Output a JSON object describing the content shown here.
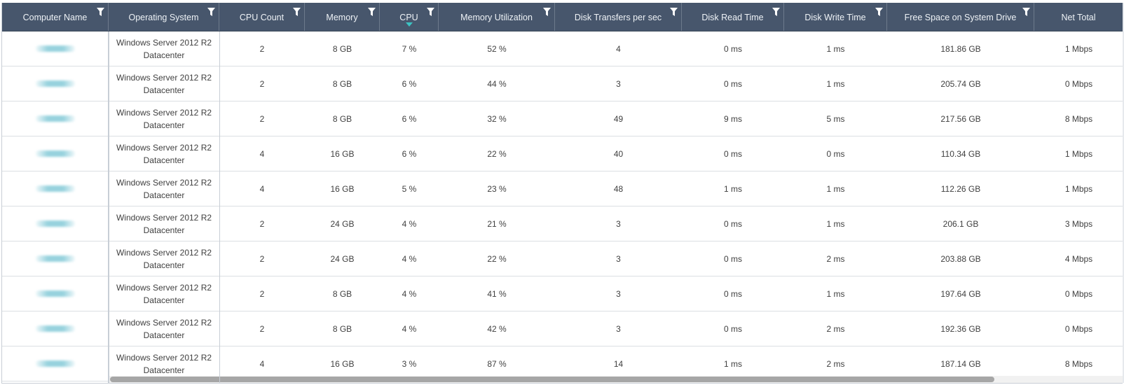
{
  "columns": [
    {
      "key": "computer",
      "label": "Computer Name"
    },
    {
      "key": "os",
      "label": "Operating System"
    },
    {
      "key": "cpu_count",
      "label": "CPU Count"
    },
    {
      "key": "memory",
      "label": "Memory"
    },
    {
      "key": "cpu",
      "label": "CPU"
    },
    {
      "key": "mem_util",
      "label": "Memory Utilization"
    },
    {
      "key": "disk_transfers",
      "label": "Disk Transfers per sec"
    },
    {
      "key": "disk_read",
      "label": "Disk Read Time"
    },
    {
      "key": "disk_write",
      "label": "Disk Write Time"
    },
    {
      "key": "free_space",
      "label": "Free Space on System Drive"
    },
    {
      "key": "net_total",
      "label": "Net Total"
    }
  ],
  "sorted_column": "cpu",
  "sort_direction": "descending",
  "icons": {
    "filter": "filter-icon",
    "sort": "sort-descending-icon"
  },
  "colors": {
    "header_bg": "#47566c",
    "sort_accent": "#3cc3c3"
  },
  "rows": [
    {
      "os": "Windows Server 2012 R2 Datacenter",
      "cpu_count": "2",
      "memory": "8 GB",
      "cpu": "7 %",
      "mem_util": "52 %",
      "disk_transfers": "4",
      "disk_read": "0 ms",
      "disk_write": "1 ms",
      "free_space": "181.86 GB",
      "net_total": "1 Mbps"
    },
    {
      "os": "Windows Server 2012 R2 Datacenter",
      "cpu_count": "2",
      "memory": "8 GB",
      "cpu": "6 %",
      "mem_util": "44 %",
      "disk_transfers": "3",
      "disk_read": "0 ms",
      "disk_write": "1 ms",
      "free_space": "205.74 GB",
      "net_total": "0 Mbps"
    },
    {
      "os": "Windows Server 2012 R2 Datacenter",
      "cpu_count": "2",
      "memory": "8 GB",
      "cpu": "6 %",
      "mem_util": "32 %",
      "disk_transfers": "49",
      "disk_read": "9 ms",
      "disk_write": "5 ms",
      "free_space": "217.56 GB",
      "net_total": "8 Mbps"
    },
    {
      "os": "Windows Server 2012 R2 Datacenter",
      "cpu_count": "4",
      "memory": "16 GB",
      "cpu": "6 %",
      "mem_util": "22 %",
      "disk_transfers": "40",
      "disk_read": "0 ms",
      "disk_write": "0 ms",
      "free_space": "110.34 GB",
      "net_total": "1 Mbps"
    },
    {
      "os": "Windows Server 2012 R2 Datacenter",
      "cpu_count": "4",
      "memory": "16 GB",
      "cpu": "5 %",
      "mem_util": "23 %",
      "disk_transfers": "48",
      "disk_read": "1 ms",
      "disk_write": "1 ms",
      "free_space": "112.26 GB",
      "net_total": "1 Mbps"
    },
    {
      "os": "Windows Server 2012 R2 Datacenter",
      "cpu_count": "2",
      "memory": "24 GB",
      "cpu": "4 %",
      "mem_util": "21 %",
      "disk_transfers": "3",
      "disk_read": "0 ms",
      "disk_write": "1 ms",
      "free_space": "206.1 GB",
      "net_total": "3 Mbps"
    },
    {
      "os": "Windows Server 2012 R2 Datacenter",
      "cpu_count": "2",
      "memory": "24 GB",
      "cpu": "4 %",
      "mem_util": "22 %",
      "disk_transfers": "3",
      "disk_read": "0 ms",
      "disk_write": "2 ms",
      "free_space": "203.88 GB",
      "net_total": "4 Mbps"
    },
    {
      "os": "Windows Server 2012 R2 Datacenter",
      "cpu_count": "2",
      "memory": "8 GB",
      "cpu": "4 %",
      "mem_util": "41 %",
      "disk_transfers": "3",
      "disk_read": "0 ms",
      "disk_write": "1 ms",
      "free_space": "197.64 GB",
      "net_total": "0 Mbps"
    },
    {
      "os": "Windows Server 2012 R2 Datacenter",
      "cpu_count": "2",
      "memory": "8 GB",
      "cpu": "4 %",
      "mem_util": "42 %",
      "disk_transfers": "3",
      "disk_read": "0 ms",
      "disk_write": "2 ms",
      "free_space": "192.36 GB",
      "net_total": "0 Mbps"
    },
    {
      "os": "Windows Server 2012 R2 Datacenter",
      "cpu_count": "4",
      "memory": "16 GB",
      "cpu": "3 %",
      "mem_util": "87 %",
      "disk_transfers": "14",
      "disk_read": "1 ms",
      "disk_write": "2 ms",
      "free_space": "187.14 GB",
      "net_total": "8 Mbps"
    }
  ]
}
